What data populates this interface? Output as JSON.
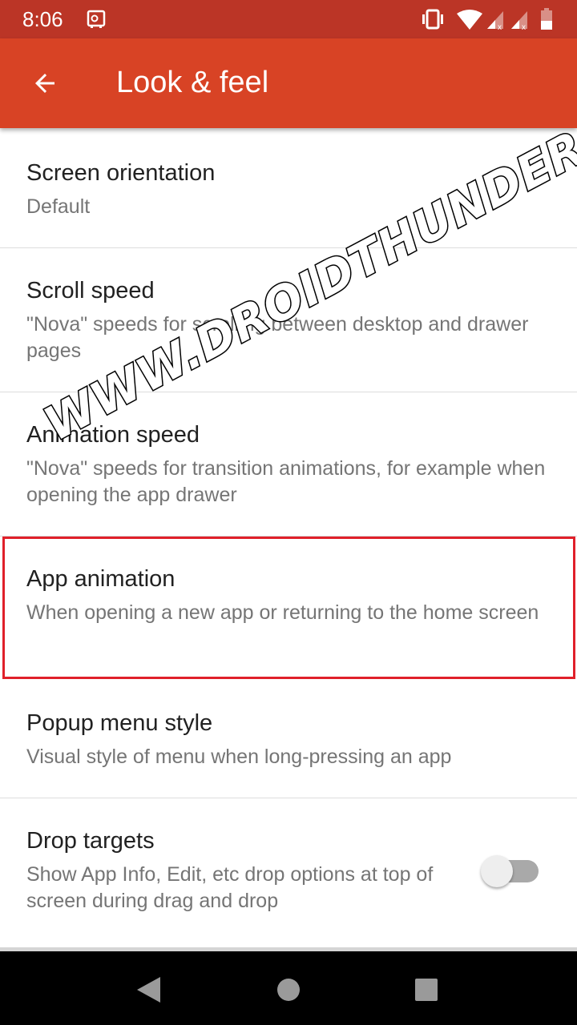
{
  "status_bar": {
    "time": "8:06",
    "icons": [
      "safe-icon",
      "vibrate-icon",
      "wifi-icon",
      "signal-no-service-icon",
      "signal-no-service-icon",
      "battery-low-icon"
    ]
  },
  "app_bar": {
    "title": "Look & feel",
    "back_icon": "arrow-left-icon"
  },
  "settings": [
    {
      "title": "Screen orientation",
      "summary": "Default"
    },
    {
      "title": "Scroll speed",
      "summary": "\"Nova\" speeds for scrolling between desktop and drawer pages"
    },
    {
      "title": "Animation speed",
      "summary": "\"Nova\" speeds for transition animations, for example when opening the app drawer"
    },
    {
      "title": "App animation",
      "summary": "When opening a new app or returning to the home screen",
      "highlighted": true
    },
    {
      "title": "Popup menu style",
      "summary": "Visual style of menu when long-pressing an app"
    },
    {
      "title": "Drop targets",
      "summary": "Show App Info, Edit, etc drop options at top of screen during drag and drop",
      "toggle": false
    }
  ],
  "watermark": "WWW.DROIDTHUNDER.COM",
  "nav_bar": {
    "buttons": [
      "back-triangle-icon",
      "home-circle-icon",
      "recents-square-icon"
    ]
  },
  "colors": {
    "status_bar": "#bb3526",
    "app_bar": "#d84325",
    "highlight": "#e0202a"
  }
}
